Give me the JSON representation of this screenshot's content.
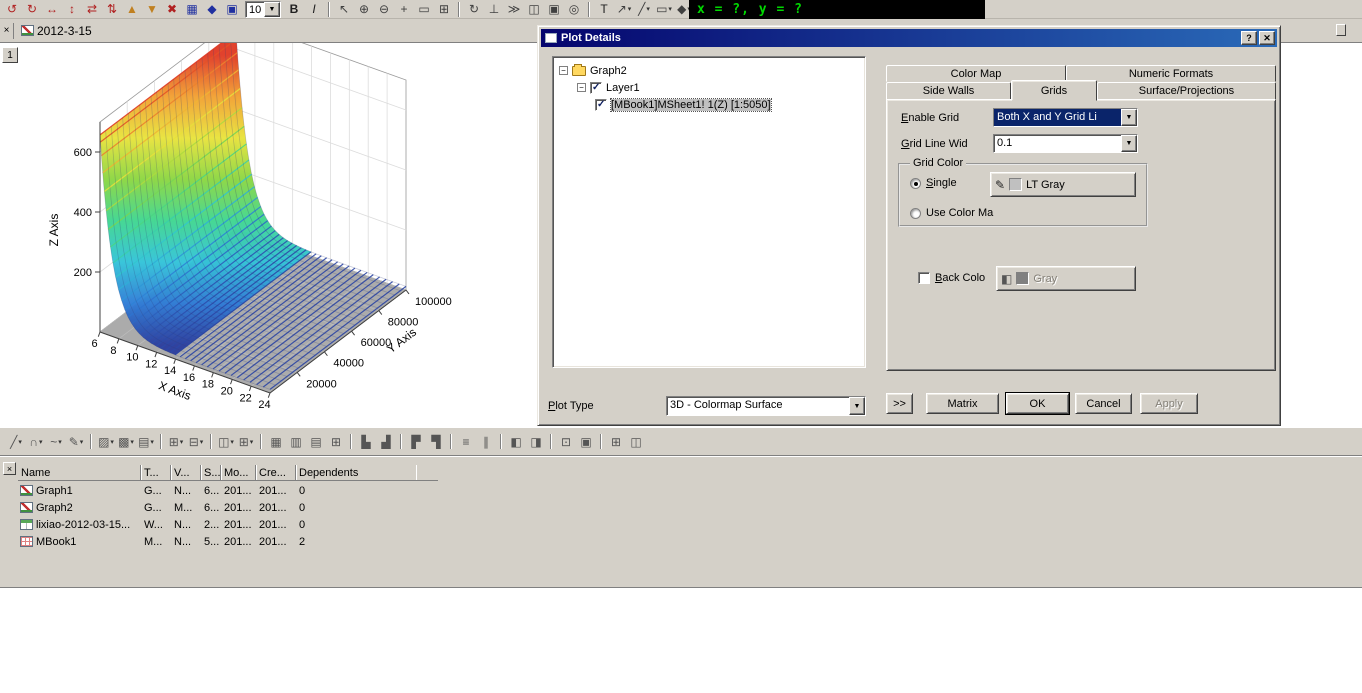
{
  "chrome": {
    "zoom_value": "10",
    "coord_readout": "x = ?, y = ?",
    "close_glyph": "×"
  },
  "window": {
    "doc_title": "2012-3-15",
    "page_number": "1"
  },
  "toolbars": {
    "top_left": [
      {
        "n": "rotate-ccw-icon",
        "g": "↺",
        "c": "#b02020"
      },
      {
        "n": "rotate-cw-icon",
        "g": "↻",
        "c": "#b02020"
      },
      {
        "n": "rotate-horizontal-icon",
        "g": "↔",
        "c": "#b02020"
      },
      {
        "n": "rotate-vertical-icon",
        "g": "↕",
        "c": "#b02020"
      },
      {
        "n": "tilt-left-icon",
        "g": "⇄",
        "c": "#b02020"
      },
      {
        "n": "tilt-right-icon",
        "g": "⇅",
        "c": "#b02020"
      },
      {
        "n": "increase-perspective-icon",
        "g": "▲",
        "c": "#c08020"
      },
      {
        "n": "decrease-perspective-icon",
        "g": "▼",
        "c": "#c08020"
      },
      {
        "n": "reset-rotation-icon",
        "g": "✖",
        "c": "#b02020"
      },
      {
        "n": "fit-frame-icon",
        "g": "▦",
        "c": "#2030a0"
      },
      {
        "n": "resize-layer-icon",
        "g": "◆",
        "c": "#2030a0"
      },
      {
        "n": "window-icon",
        "g": "▣",
        "c": "#2030a0"
      }
    ],
    "top_right": [
      {
        "n": "bold-icon",
        "g": "B",
        "c": "#202020",
        "b": 1
      },
      {
        "n": "italic-icon",
        "g": "I",
        "c": "#202020",
        "i": 1
      },
      {
        "sep": true
      },
      {
        "n": "pointer-icon",
        "g": "↖",
        "c": "#404040"
      },
      {
        "n": "zoom-in-icon",
        "g": "⊕",
        "c": "#404040"
      },
      {
        "n": "zoom-out-icon",
        "g": "⊖",
        "c": "#404040"
      },
      {
        "n": "pan-icon",
        "g": "+",
        "c": "#404040"
      },
      {
        "n": "rescale-icon",
        "g": "▭",
        "c": "#404040"
      },
      {
        "n": "grid-toggle-icon",
        "g": "⊞",
        "c": "#404040"
      },
      {
        "sep": true
      },
      {
        "n": "rotate-tool-icon",
        "g": "↻",
        "c": "#404040"
      },
      {
        "n": "axis-tool-icon",
        "g": "⊥",
        "c": "#404040"
      },
      {
        "n": "speed-mode-icon",
        "g": "≫",
        "c": "#404040"
      },
      {
        "n": "layer-tool-icon",
        "g": "◫",
        "c": "#404040"
      },
      {
        "n": "frame-tool-icon",
        "g": "▣",
        "c": "#404040"
      },
      {
        "n": "data-reader-icon",
        "g": "◎",
        "c": "#404040"
      },
      {
        "sep": true
      },
      {
        "n": "text-tool-icon",
        "g": "T",
        "c": "#202020"
      },
      {
        "n": "arrow-tool-icon",
        "g": "↗",
        "c": "#404040",
        "dd": 1
      },
      {
        "n": "line-tool-icon",
        "g": "╱",
        "c": "#404040",
        "dd": 1
      },
      {
        "n": "rectangle-tool-icon",
        "g": "▭",
        "c": "#404040",
        "dd": 1
      },
      {
        "n": "symbol-tool-icon",
        "g": "◆",
        "c": "#404040",
        "dd": 1
      }
    ],
    "graph": [
      {
        "n": "line-style-icon",
        "g": "╱",
        "dd": 1
      },
      {
        "n": "arc-tool-icon",
        "g": "∩",
        "dd": 1
      },
      {
        "n": "curve-tool-icon",
        "g": "~",
        "dd": 1
      },
      {
        "n": "freehand-tool-icon",
        "g": "✎",
        "dd": 1
      },
      {
        "sep": true
      },
      {
        "n": "fill-color-icon",
        "g": "▨",
        "dd": 1
      },
      {
        "n": "pattern-icon",
        "g": "▩",
        "dd": 1
      },
      {
        "n": "line-color-icon",
        "g": "▤",
        "dd": 1
      },
      {
        "sep": true
      },
      {
        "n": "add-plot-icon",
        "g": "⊞",
        "dd": 1
      },
      {
        "n": "remove-plot-icon",
        "g": "⊟",
        "dd": 1
      },
      {
        "sep": true
      },
      {
        "n": "merge-cells-icon",
        "g": "◫",
        "dd": 1
      },
      {
        "n": "extract-cells-icon",
        "g": "⊞",
        "dd": 1
      },
      {
        "sep": true
      },
      {
        "n": "worksheet-grid-icon",
        "g": "▦"
      },
      {
        "n": "column-header-icon",
        "g": "▥"
      },
      {
        "n": "row-header-icon",
        "g": "▤"
      },
      {
        "n": "cell-borders-icon",
        "g": "⊞"
      },
      {
        "sep": true
      },
      {
        "n": "align-left-icon",
        "g": "▙"
      },
      {
        "n": "align-right-icon",
        "g": "▟"
      },
      {
        "sep": true
      },
      {
        "n": "align-top-icon",
        "g": "▛"
      },
      {
        "n": "align-bottom-icon",
        "g": "▜"
      },
      {
        "sep": true
      },
      {
        "n": "distribute-horizontal-icon",
        "g": "≡"
      },
      {
        "n": "distribute-vertical-icon",
        "g": "∥"
      },
      {
        "sep": true
      },
      {
        "n": "new-layer-icon",
        "g": "◧"
      },
      {
        "n": "delete-layer-icon",
        "g": "◨"
      },
      {
        "sep": true
      },
      {
        "n": "zoom-panel-icon",
        "g": "⊡"
      },
      {
        "n": "fit-page-icon",
        "g": "▣"
      },
      {
        "sep": true
      },
      {
        "n": "arrange-layers-icon",
        "g": "⊞"
      },
      {
        "n": "layout-icon",
        "g": "◫"
      }
    ]
  },
  "chart_data": {
    "type": "surface3d",
    "title": "",
    "x_axis": {
      "label": "X Axis",
      "range": [
        6,
        24
      ],
      "ticks": [
        6,
        8,
        10,
        12,
        14,
        16,
        18,
        20,
        22,
        24
      ]
    },
    "y_axis": {
      "label": "Y Axis",
      "range": [
        0,
        100000
      ],
      "ticks": [
        20000,
        40000,
        60000,
        80000,
        100000
      ]
    },
    "z_axis": {
      "label": "Z Axis",
      "range": [
        0,
        700
      ],
      "ticks": [
        200,
        400,
        600
      ]
    },
    "surface": {
      "description": "colormap surface with sharp exponential decay ridge along minimum X, flat near zero elsewhere",
      "peak_z": 645,
      "base_z": 12,
      "decay_constant": 1.35
    },
    "colormap": [
      "#2c3e9e",
      "#2e7bd6",
      "#31c3d8",
      "#3fd68f",
      "#8bd641",
      "#e8e33b",
      "#f2a031",
      "#e03a24"
    ],
    "floor_color": "#ababab",
    "grid": true
  },
  "plot_details": {
    "title": "Plot Details",
    "titlebar_buttons": {
      "help": "?",
      "close": "✕"
    },
    "tree": {
      "expander": "−",
      "root": "Graph2",
      "layer": "Layer1",
      "dataset": "[MBook1]MSheet1! 1(Z) [1:5050]"
    },
    "tabs": {
      "color_map": "Color Map",
      "numeric_formats": "Numeric Formats",
      "side_walls": "Side Walls",
      "grids": "Grids",
      "surface_projections": "Surface/Projections"
    },
    "grids_tab": {
      "enable_grid_label": "Enable Grid",
      "enable_grid_value": "Both X and Y Grid Li",
      "grid_line_width_label": "Grid Line Wid",
      "grid_line_width_value": "0.1",
      "grid_color_label": "Grid Color",
      "single_label": "Single",
      "single_color_name": "LT Gray",
      "single_swatch_style": "background:#c0c0c0",
      "use_color_map_label": "Use Color Ma",
      "back_color_label": "Back Colo",
      "back_color_name": "Gray",
      "back_swatch_style": "background:#808080"
    },
    "plot_type_label": "Plot Type",
    "plot_type_value": "3D - Colormap Surface",
    "buttons": {
      "more": ">>",
      "matrix": "Matrix",
      "ok": "OK",
      "cancel": "Cancel",
      "apply": "Apply"
    }
  },
  "explorer": {
    "columns": [
      "Name",
      "T...",
      "V...",
      "S...",
      "Mo...",
      "Cre...",
      "Dependents"
    ],
    "rows": [
      {
        "icon": "graph",
        "name": "Graph1",
        "type": "G...",
        "view": "N...",
        "size": "6...",
        "modified": "201...",
        "created": "201...",
        "dependents": "0"
      },
      {
        "icon": "graph",
        "name": "Graph2",
        "type": "G...",
        "view": "M...",
        "size": "6...",
        "modified": "201...",
        "created": "201...",
        "dependents": "0"
      },
      {
        "icon": "worksheet",
        "name": "lixiao-2012-03-15...",
        "type": "W...",
        "view": "N...",
        "size": "2...",
        "modified": "201...",
        "created": "201...",
        "dependents": "0"
      },
      {
        "icon": "matrix",
        "name": "MBook1",
        "type": "M...",
        "view": "N...",
        "size": "5...",
        "modified": "201...",
        "created": "201...",
        "dependents": "2"
      }
    ]
  }
}
